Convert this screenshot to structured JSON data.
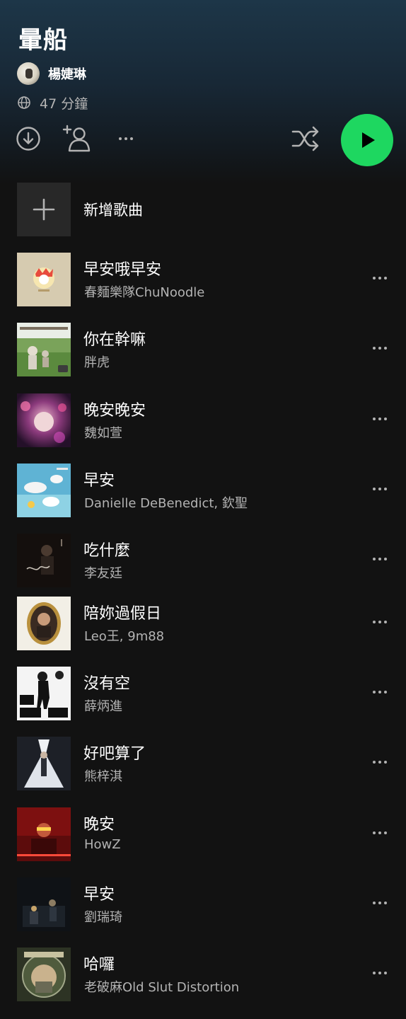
{
  "playlist": {
    "title": "暈船",
    "owner": "楊婕琳",
    "duration": "47 分鐘"
  },
  "toolbar": {
    "download_icon": "download-icon",
    "add_user_icon": "add-user-icon",
    "more_icon": "more-options-icon",
    "shuffle_icon": "shuffle-icon",
    "play_icon": "play-icon",
    "play_color": "#1ed760"
  },
  "add_songs": {
    "label": "新增歌曲",
    "icon": "plus-icon"
  },
  "tracks": [
    {
      "title": "早安哦早安",
      "artist": "春麵樂隊ChuNoodle"
    },
    {
      "title": "你在幹嘛",
      "artist": "胖虎"
    },
    {
      "title": "晚安晚安",
      "artist": "魏如萱"
    },
    {
      "title": "早安",
      "artist": "Danielle DeBenedict, 欽聖"
    },
    {
      "title": "吃什麼",
      "artist": "李友廷"
    },
    {
      "title": "陪妳過假日",
      "artist": "Leo王, 9m88"
    },
    {
      "title": "沒有空",
      "artist": "薛炳進"
    },
    {
      "title": "好吧算了",
      "artist": "熊梓淇"
    },
    {
      "title": "晚安",
      "artist": "HowZ"
    },
    {
      "title": "早安",
      "artist": "劉瑞琦"
    },
    {
      "title": "哈囉",
      "artist": "老破麻Old Slut Distortion"
    }
  ],
  "colors": {
    "background": "#121212",
    "accent": "#1ed760",
    "secondary_text": "#b3b3b3"
  }
}
